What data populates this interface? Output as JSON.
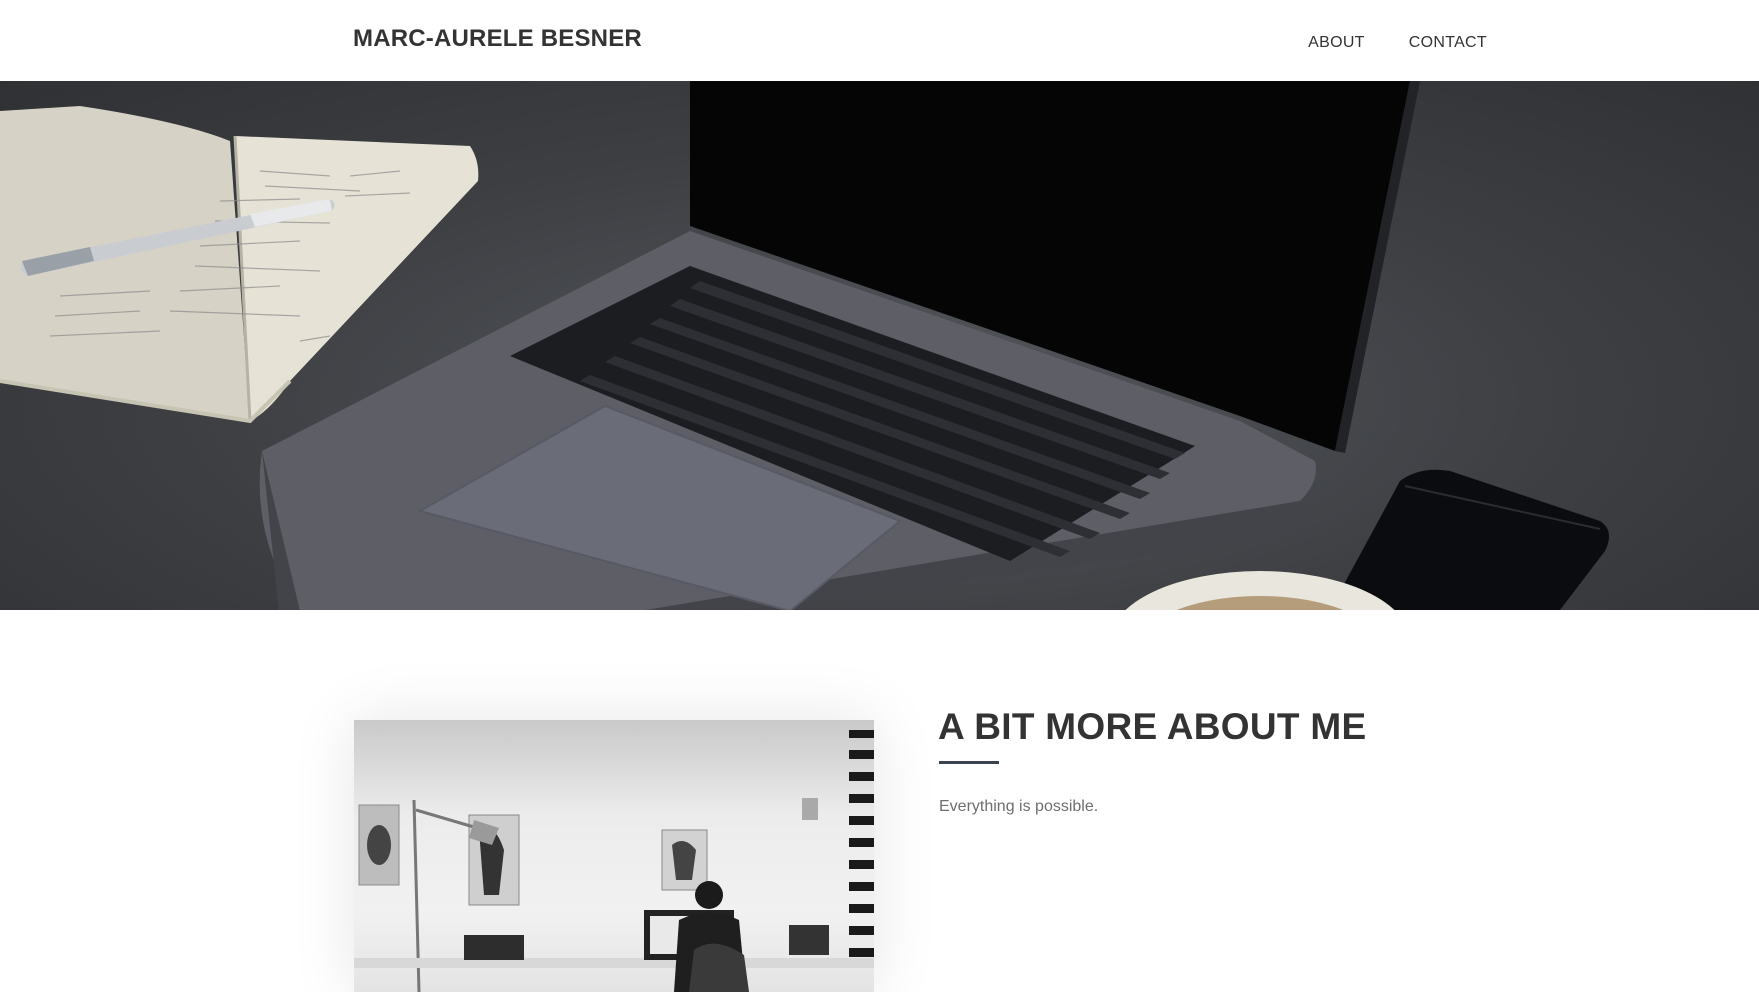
{
  "header": {
    "brand": "MARC-AURELE BESNER",
    "nav": [
      {
        "label": "ABOUT"
      },
      {
        "label": "CONTACT"
      }
    ]
  },
  "hero": {
    "image": "laptop-desk-photo",
    "objects": [
      "notebook",
      "pen",
      "laptop",
      "smartphone",
      "coffee-cup"
    ]
  },
  "about": {
    "image": "home-office-photo",
    "title": "A BIT MORE ABOUT ME",
    "text": "Everything is possible."
  },
  "colors": {
    "text": "#333333",
    "muted": "#6e6e6e",
    "accent_rule": "#3b4252",
    "background": "#ffffff"
  }
}
